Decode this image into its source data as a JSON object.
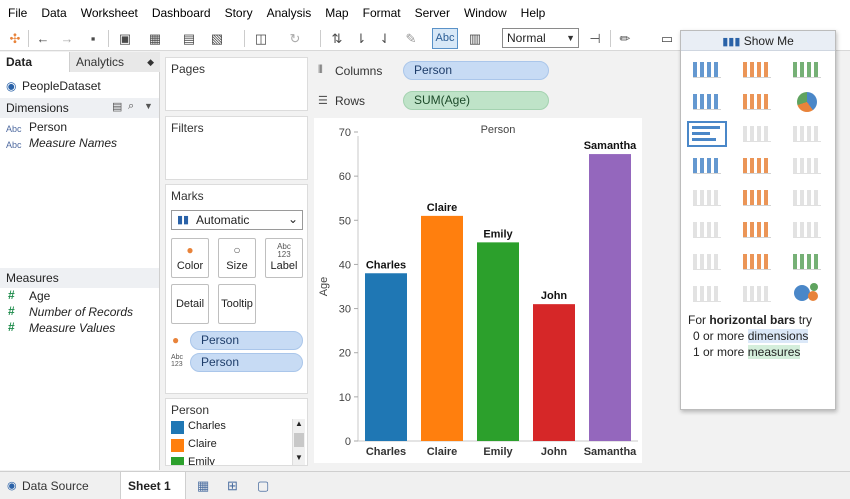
{
  "menu": [
    "File",
    "Data",
    "Worksheet",
    "Dashboard",
    "Story",
    "Analysis",
    "Map",
    "Format",
    "Server",
    "Window",
    "Help"
  ],
  "toolbar": {
    "label_button": "Abc",
    "fit_value": "Normal"
  },
  "data_pane": {
    "tabs": [
      "Data",
      "Analytics"
    ],
    "datasource": "PeopleDataset",
    "dimensions_header": "Dimensions",
    "dimensions": [
      "Person",
      "Measure Names"
    ],
    "measures_header": "Measures",
    "measures": [
      "Age",
      "Number of Records",
      "Measure Values"
    ]
  },
  "shelves": {
    "pages": "Pages",
    "filters": "Filters",
    "columns_label": "Columns",
    "rows_label": "Rows",
    "columns_pill": "Person",
    "rows_pill": "SUM(Age)"
  },
  "marks": {
    "title": "Marks",
    "type": "Automatic",
    "buttons": [
      "Color",
      "Size",
      "Label",
      "Detail",
      "Tooltip"
    ],
    "pills": [
      "Person",
      "Person"
    ]
  },
  "legend": {
    "title": "Person",
    "items": [
      {
        "name": "Charles",
        "color": "#1f77b4"
      },
      {
        "name": "Claire",
        "color": "#ff7f0e"
      },
      {
        "name": "Emily",
        "color": "#2ca02c"
      }
    ]
  },
  "show_me": {
    "title": "Show Me",
    "hint_prefix": "For ",
    "hint_bold": "horizontal bars",
    "hint_suffix": " try",
    "req1_prefix": "0 or more ",
    "req1_word": "dimensions",
    "req2_prefix": "1 or more ",
    "req2_word": "measures"
  },
  "bottom": {
    "datasource_tab": "Data Source",
    "sheet_tab": "Sheet 1"
  },
  "chart_data": {
    "type": "bar",
    "title": "Person",
    "ylabel": "Age",
    "ylim": [
      0,
      70
    ],
    "yticks": [
      0,
      10,
      20,
      30,
      40,
      50,
      60,
      70
    ],
    "categories": [
      "Charles",
      "Claire",
      "Emily",
      "John",
      "Samantha"
    ],
    "values": [
      38,
      51,
      45,
      31,
      65
    ],
    "colors": [
      "#1f77b4",
      "#ff7f0e",
      "#2ca02c",
      "#d62728",
      "#9467bd"
    ]
  }
}
